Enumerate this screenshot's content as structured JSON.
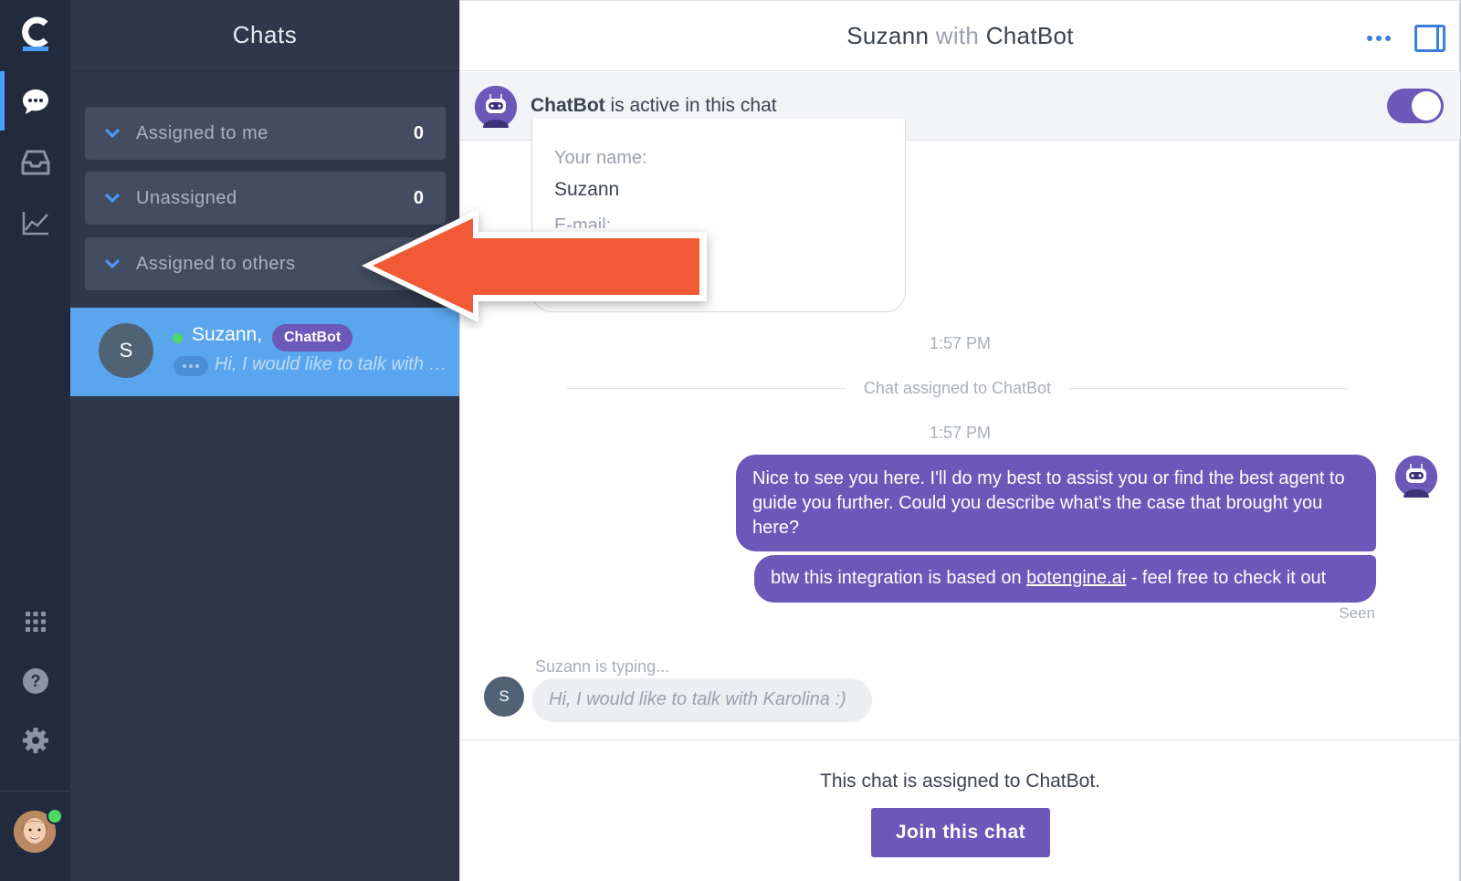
{
  "rail": {
    "icons": [
      "logo-icon",
      "chats-icon",
      "archive-inbox-icon",
      "reports-chart-icon",
      "apps-grid-icon",
      "help-icon",
      "settings-gear-icon"
    ]
  },
  "chat_list": {
    "title": "Chats",
    "groups": [
      {
        "label": "Assigned to me",
        "count": "0"
      },
      {
        "label": "Unassigned",
        "count": "0"
      },
      {
        "label": "Assigned to others",
        "count": ""
      }
    ],
    "active_chat": {
      "avatar_letter": "S",
      "name": "Suzann,",
      "badge": "ChatBot",
      "preview": "Hi, I would like to talk with Karolina :)"
    }
  },
  "header": {
    "customer": "Suzann",
    "with": "with",
    "agent": "ChatBot"
  },
  "bot_bar": {
    "bot_name": "ChatBot",
    "status_text": "is active in this chat",
    "toggle_on": true
  },
  "form": {
    "name_label": "Your name:",
    "name_value": "Suzann",
    "email_label": "E-mail:"
  },
  "timeline": {
    "time1": "1:57 PM",
    "system_event": "Chat assigned to ChatBot",
    "time2": "1:57 PM",
    "bot_message_1": "Nice to see you here. I'll do my best to assist you or find the best agent to guide you further. Could you describe what's the case that brought you here?",
    "bot_message_2_pre": "btw this integration is based on ",
    "bot_message_2_link": "botengine.ai",
    "bot_message_2_post": " - feel free to check it out",
    "seen": "Seen",
    "typing_label": "Suzann is typing...",
    "customer_avatar_letter": "S",
    "customer_typing_text": "Hi, I would like to talk with Karolina :)"
  },
  "footer": {
    "assigned_text": "This chat is assigned to ChatBot.",
    "join_button": "Join this chat"
  },
  "colors": {
    "rail_bg": "#222b3d",
    "panel_bg": "#2f374a",
    "active_chat": "#5aa6ee",
    "bot_purple": "#6b58b8",
    "accent_blue": "#3a7fd8",
    "arrow_orange": "#f15a35"
  }
}
